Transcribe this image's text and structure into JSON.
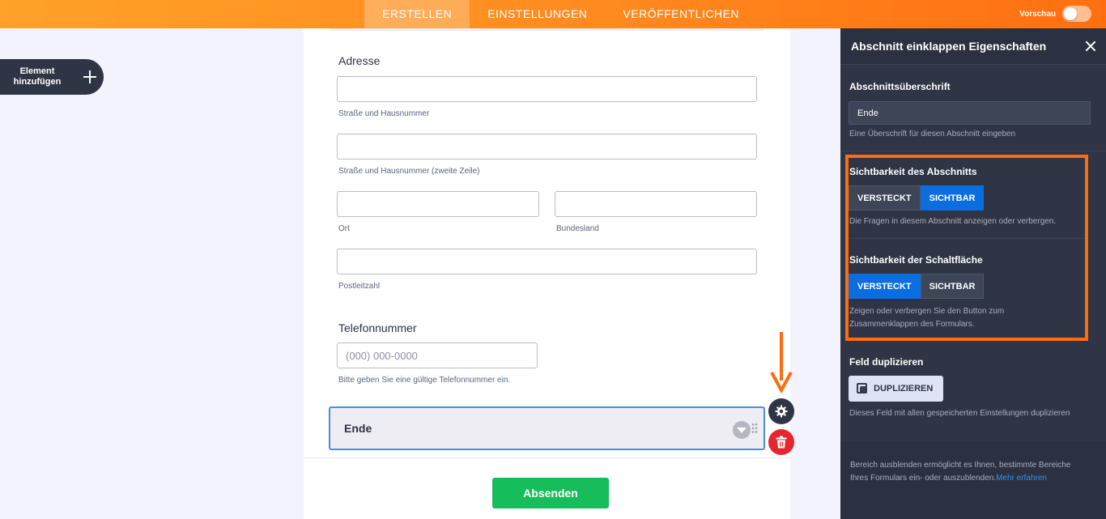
{
  "topbar": {
    "tabs": [
      {
        "label": "ERSTELLEN",
        "active": true
      },
      {
        "label": "EINSTELLUNGEN",
        "active": false
      },
      {
        "label": "VERÖFFENTLICHEN",
        "active": false
      }
    ],
    "preview_label": "Vorschau",
    "preview_on": false
  },
  "sidebar": {
    "add_element_label": "Element hinzufügen"
  },
  "form": {
    "address": {
      "label": "Adresse",
      "street_sublabel": "Straße und Hausnummer",
      "street2_sublabel": "Straße und Hausnummer (zweite Zeile)",
      "city_sublabel": "Ort",
      "state_sublabel": "Bundesland",
      "zip_sublabel": "Postleitzahl"
    },
    "phone": {
      "label": "Telefonnummer",
      "placeholder": "(000) 000-0000",
      "sublabel": "Bitte geben Sie eine gültige Telefonnummer ein."
    },
    "section": {
      "title": "Ende"
    },
    "submit_label": "Absenden"
  },
  "panel": {
    "title": "Abschnitt einklappen Eigenschaften",
    "heading_field": {
      "title": "Abschnittsüberschrift",
      "value": "Ende",
      "description": "Eine Überschrift für diesen Abschnitt eingeben"
    },
    "section_visibility": {
      "title": "Sichtbarkeit des Abschnitts",
      "options": [
        "VERSTECKT",
        "SICHTBAR"
      ],
      "selected": "SICHTBAR",
      "description": "Die Fragen in diesem Abschnitt anzeigen oder verbergen."
    },
    "button_visibility": {
      "title": "Sichtbarkeit der Schaltfläche",
      "options": [
        "VERSTECKT",
        "SICHTBAR"
      ],
      "selected": "VERSTECKT",
      "description": "Zeigen oder verbergen Sie den Button zum Zusammenklappen des Formulars."
    },
    "duplicate": {
      "title": "Feld duplizieren",
      "button_label": "DUPLIZIEREN",
      "description": "Dieses Feld mit allen gespeicherten Einstellungen duplizieren"
    },
    "info": {
      "text": "Bereich ausblenden ermöglicht es Ihnen, bestimmte Bereiche Ihres Formulars ein- oder auszublenden.",
      "link": "Mehr erfahren"
    }
  },
  "colors": {
    "accent_orange": "#ff6b10",
    "primary_blue": "#0a6ee0",
    "submit_green": "#18bd5b",
    "delete_red": "#e6262f",
    "panel_bg": "#2f3544"
  }
}
